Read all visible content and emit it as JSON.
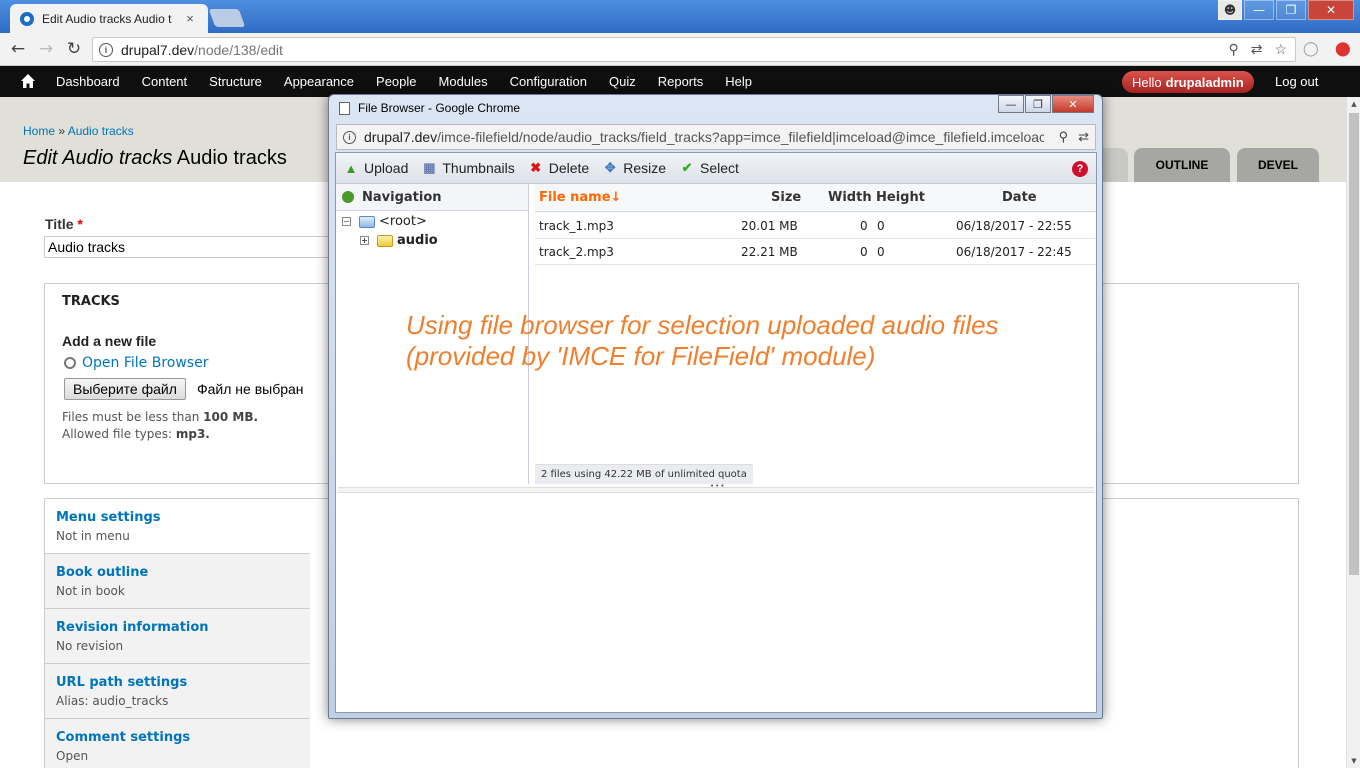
{
  "browser": {
    "tab_title": "Edit Audio tracks Audio t",
    "tab_close": "×",
    "url_host": "drupal7.dev",
    "url_path": "/node/138/edit",
    "window_buttons": [
      "—",
      "❐",
      "✕"
    ]
  },
  "toolbar": {
    "items": [
      "Dashboard",
      "Content",
      "Structure",
      "Appearance",
      "People",
      "Modules",
      "Configuration",
      "Quiz",
      "Reports",
      "Help"
    ],
    "hello_prefix": "Hello",
    "username": "drupaladmin",
    "logout": "Log out"
  },
  "page": {
    "breadcrumb_home": "Home",
    "breadcrumb_sep": " » ",
    "breadcrumb_section": "Audio tracks",
    "title_em": "Edit Audio tracks",
    "title_rest": " Audio tracks",
    "tabs": [
      "OUTLINE",
      "DEVEL"
    ]
  },
  "form": {
    "title_label": "Title",
    "required_mark": "*",
    "title_value": "Audio tracks",
    "tracks_legend": "TRACKS",
    "add_new_file": "Add a new file",
    "open_file_browser": "Open File Browser",
    "choose_file_button": "Выберите файл",
    "no_file_chosen": "Файл не выбран",
    "help_size_prefix": "Files must be less than ",
    "help_size_value": "100 MB.",
    "help_types_prefix": "Allowed file types: ",
    "help_types_value": "mp3."
  },
  "vertical_tabs": [
    {
      "title": "Menu settings",
      "summary": "Not in menu"
    },
    {
      "title": "Book outline",
      "summary": "Not in book"
    },
    {
      "title": "Revision information",
      "summary": "No revision"
    },
    {
      "title": "URL path settings",
      "summary": "Alias: audio_tracks"
    },
    {
      "title": "Comment settings",
      "summary": "Open"
    }
  ],
  "popup": {
    "window_title": "File Browser - Google Chrome",
    "url_host": "drupal7.dev",
    "url_path": "/imce-filefield/node/audio_tracks/field_tracks?app=imce_filefield|imceload@imce_filefield.imceloac",
    "operations": [
      "Upload",
      "Thumbnails",
      "Delete",
      "Resize",
      "Select"
    ],
    "help_icon": "?",
    "navigation_label": "Navigation",
    "tree_root": "<root>",
    "tree_child": "audio",
    "columns": {
      "name": "File name↓",
      "size": "Size",
      "width": "Width",
      "height": "Height",
      "date": "Date"
    },
    "files": [
      {
        "name": "track_1.mp3",
        "size": "20.01 MB",
        "width": "0",
        "height": "0",
        "date": "06/18/2017 - 22:55"
      },
      {
        "name": "track_2.mp3",
        "size": "22.21 MB",
        "width": "0",
        "height": "0",
        "date": "06/18/2017 - 22:45"
      }
    ],
    "quota": "2 files using 42.22 MB of unlimited quota"
  },
  "annotation": {
    "line1": "Using file browser for selection uploaded audio files",
    "line2": "(provided by 'IMCE for FileField' module)"
  },
  "colors": {
    "link": "#0074bd",
    "sorted_column": "#ff6600",
    "annotation": "#f07f2d",
    "hello_badge": "#c0302c"
  }
}
